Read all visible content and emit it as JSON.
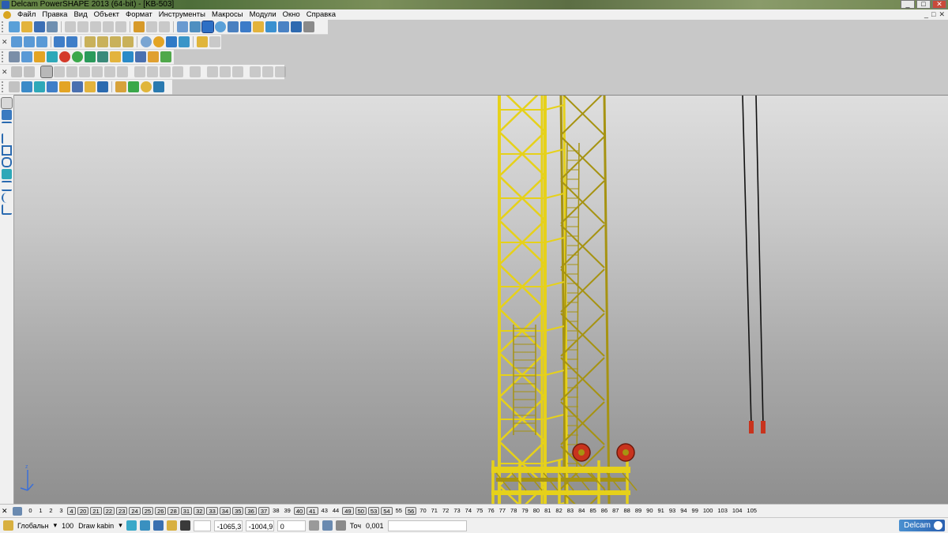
{
  "window": {
    "title": "Delcam PowerSHAPE 2013 (64-bit) - [KB-503]",
    "controls": [
      "_",
      "□",
      "✕"
    ]
  },
  "menubar": {
    "items": [
      "Файл",
      "Правка",
      "Вид",
      "Объект",
      "Формат",
      "Инструменты",
      "Макросы",
      "Модули",
      "Окно",
      "Справка"
    ],
    "mdi_controls": [
      "_",
      "□",
      "✕"
    ]
  },
  "colors": {
    "crane_yellow": "#e6d11a",
    "crane_yellow_dark": "#a69312",
    "hook_red": "#c8331d",
    "cable": "#111111"
  },
  "level_bar": {
    "levels": [
      {
        "n": "0",
        "on": false
      },
      {
        "n": "1",
        "on": false
      },
      {
        "n": "2",
        "on": false
      },
      {
        "n": "3",
        "on": false
      },
      {
        "n": "4",
        "on": true
      },
      {
        "n": "20",
        "on": true
      },
      {
        "n": "21",
        "on": true
      },
      {
        "n": "22",
        "on": true
      },
      {
        "n": "23",
        "on": true
      },
      {
        "n": "24",
        "on": true
      },
      {
        "n": "25",
        "on": true
      },
      {
        "n": "26",
        "on": true
      },
      {
        "n": "28",
        "on": true
      },
      {
        "n": "31",
        "on": true
      },
      {
        "n": "32",
        "on": true
      },
      {
        "n": "33",
        "on": true
      },
      {
        "n": "34",
        "on": true
      },
      {
        "n": "35",
        "on": true
      },
      {
        "n": "36",
        "on": true
      },
      {
        "n": "37",
        "on": true
      },
      {
        "n": "38",
        "on": false
      },
      {
        "n": "39",
        "on": false
      },
      {
        "n": "40",
        "on": true
      },
      {
        "n": "41",
        "on": true
      },
      {
        "n": "43",
        "on": false
      },
      {
        "n": "44",
        "on": false
      },
      {
        "n": "49",
        "on": true
      },
      {
        "n": "50",
        "on": true
      },
      {
        "n": "53",
        "on": true
      },
      {
        "n": "54",
        "on": true
      },
      {
        "n": "55",
        "on": false
      },
      {
        "n": "56",
        "on": true
      },
      {
        "n": "70",
        "on": false
      },
      {
        "n": "71",
        "on": false
      },
      {
        "n": "72",
        "on": false
      },
      {
        "n": "73",
        "on": false
      },
      {
        "n": "74",
        "on": false
      },
      {
        "n": "75",
        "on": false
      },
      {
        "n": "76",
        "on": false
      },
      {
        "n": "77",
        "on": false
      },
      {
        "n": "78",
        "on": false
      },
      {
        "n": "79",
        "on": false
      },
      {
        "n": "80",
        "on": false
      },
      {
        "n": "81",
        "on": false
      },
      {
        "n": "82",
        "on": false
      },
      {
        "n": "83",
        "on": false
      },
      {
        "n": "84",
        "on": false
      },
      {
        "n": "85",
        "on": false
      },
      {
        "n": "86",
        "on": false
      },
      {
        "n": "87",
        "on": false
      },
      {
        "n": "88",
        "on": false
      },
      {
        "n": "89",
        "on": false
      },
      {
        "n": "90",
        "on": false
      },
      {
        "n": "91",
        "on": false
      },
      {
        "n": "93",
        "on": false
      },
      {
        "n": "94",
        "on": false
      },
      {
        "n": "99",
        "on": false
      },
      {
        "n": "100",
        "on": false
      },
      {
        "n": "103",
        "on": false
      },
      {
        "n": "104",
        "on": false
      },
      {
        "n": "105",
        "on": false
      }
    ]
  },
  "status": {
    "workplane": "Глобальн",
    "level_number": "100",
    "level_name": "Draw kabin",
    "coord_x": "-1065,3",
    "coord_y": "-1004,9",
    "coord_z": "0",
    "tolerance_label": "Точ",
    "tolerance_value": "0,001",
    "brand": "Delcam"
  }
}
